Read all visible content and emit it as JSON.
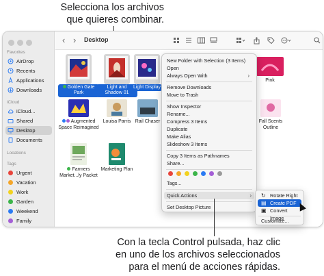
{
  "callout_top": [
    "Selecciona los archivos",
    "que quieres combinar."
  ],
  "callout_bottom": [
    "Con la tecla Control pulsada, haz clic",
    "en uno de los archivos seleccionados",
    "para el menú de acciones rápidas."
  ],
  "toolbar": {
    "title": "Desktop",
    "back": "‹",
    "forward": "›",
    "search": "⌕"
  },
  "sidebar": {
    "sections": [
      {
        "head": "Favorites",
        "items": [
          {
            "label": "AirDrop",
            "icon": "airdrop-icon",
            "color": "#2b7bf3"
          },
          {
            "label": "Recents",
            "icon": "clock-icon",
            "color": "#2b7bf3"
          },
          {
            "label": "Applications",
            "icon": "applications-icon",
            "color": "#2b7bf3"
          },
          {
            "label": "Downloads",
            "icon": "download-icon",
            "color": "#2b7bf3"
          }
        ]
      },
      {
        "head": "iCloud",
        "items": [
          {
            "label": "iCloud...",
            "icon": "cloud-icon",
            "color": "#2b7bf3"
          },
          {
            "label": "Shared",
            "icon": "shared-folder-icon",
            "color": "#2b7bf3"
          },
          {
            "label": "Desktop",
            "icon": "desktop-icon",
            "color": "#2b7bf3",
            "selected": true
          },
          {
            "label": "Documents",
            "icon": "document-icon",
            "color": "#2b7bf3"
          }
        ]
      },
      {
        "head": "Locations",
        "items": []
      },
      {
        "head": "Tags",
        "items": [
          {
            "label": "Urgent",
            "color": "#e8453c"
          },
          {
            "label": "Vacation",
            "color": "#f4a62a"
          },
          {
            "label": "Work",
            "color": "#f2d21f"
          },
          {
            "label": "Garden",
            "color": "#3cb54a"
          },
          {
            "label": "Weekend",
            "color": "#2b7bf3"
          },
          {
            "label": "Family",
            "color": "#a45fd6"
          }
        ]
      }
    ]
  },
  "files": {
    "golden_gate": "Golden Gate Park",
    "light_shadow": "Light and Shadow 01",
    "light_display": "Light Display",
    "augmented": [
      "Augmented",
      "Space Reimagined"
    ],
    "louisa": "Louisa Parris",
    "rail": "Rail Chaser",
    "farmers": [
      "Farmers",
      "Market...ly Packet"
    ],
    "marketing": "Marketing Plan",
    "pink": "Pink",
    "fall": [
      "Fall Scents",
      "Outline"
    ]
  },
  "menu": {
    "items": [
      "New Folder with Selection (3 Items)",
      "Open",
      "Always Open With",
      "Remove Downloads",
      "Move to Trash",
      "Show Inspector",
      "Rename...",
      "Compress 3 Items",
      "Duplicate",
      "Make Alias",
      "Slideshow 3 Items",
      "Copy 3 Items as Pathnames",
      "Share...",
      "Tags...",
      "Quick Actions",
      "Set Desktop Picture"
    ],
    "tag_colors": [
      "#e8453c",
      "#f4a62a",
      "#f2d21f",
      "#3cb54a",
      "#2b7bf3",
      "#a45fd6",
      "#9a9a9a"
    ]
  },
  "submenu": {
    "items": [
      "Rotate Right",
      "Create PDF",
      "Convert Image",
      "Customize..."
    ]
  }
}
